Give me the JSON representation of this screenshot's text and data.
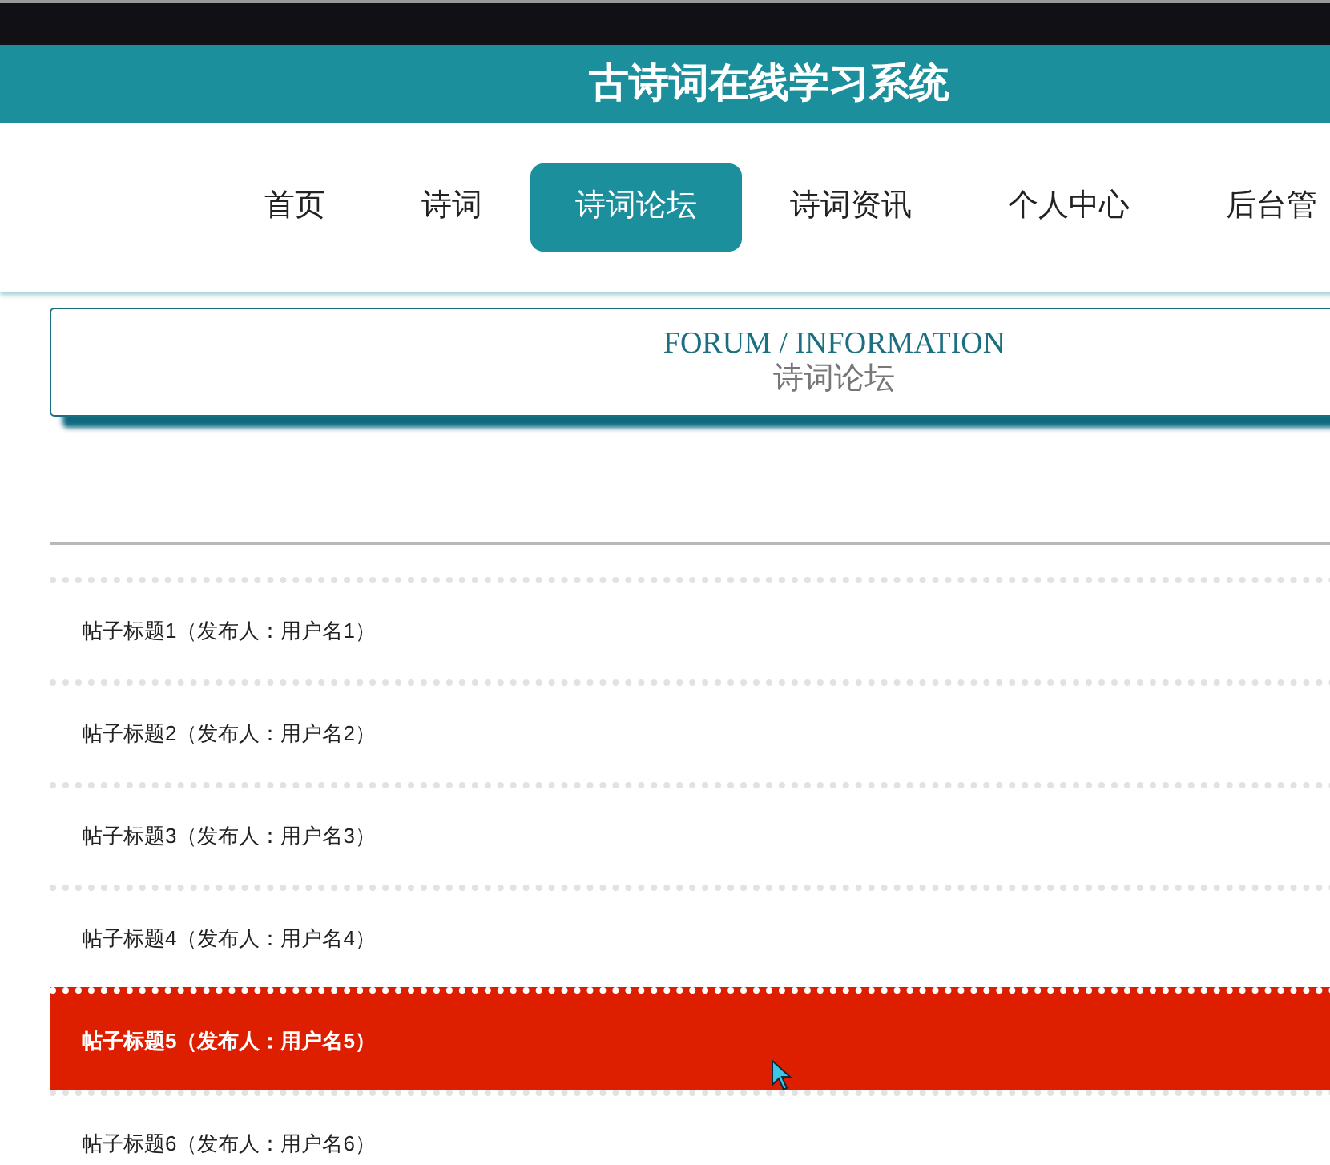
{
  "site_title": "古诗词在线学习系统",
  "nav": [
    {
      "label": "首页",
      "selected": false
    },
    {
      "label": "诗词",
      "selected": false
    },
    {
      "label": "诗词论坛",
      "selected": true
    },
    {
      "label": "诗词资讯",
      "selected": false
    },
    {
      "label": "个人中心",
      "selected": false
    },
    {
      "label": "后台管",
      "selected": false
    }
  ],
  "banner": {
    "english": "FORUM / INFORMATION",
    "chinese": "诗词论坛"
  },
  "posts": [
    {
      "title": "帖子标题1（发布人：用户名1）",
      "highlighted": false
    },
    {
      "title": "帖子标题2（发布人：用户名2）",
      "highlighted": false
    },
    {
      "title": "帖子标题3（发布人：用户名3）",
      "highlighted": false
    },
    {
      "title": "帖子标题4（发布人：用户名4）",
      "highlighted": false
    },
    {
      "title": "帖子标题5（发布人：用户名5）",
      "highlighted": true
    },
    {
      "title": "帖子标题6（发布人：用户名6）",
      "highlighted": false
    }
  ]
}
